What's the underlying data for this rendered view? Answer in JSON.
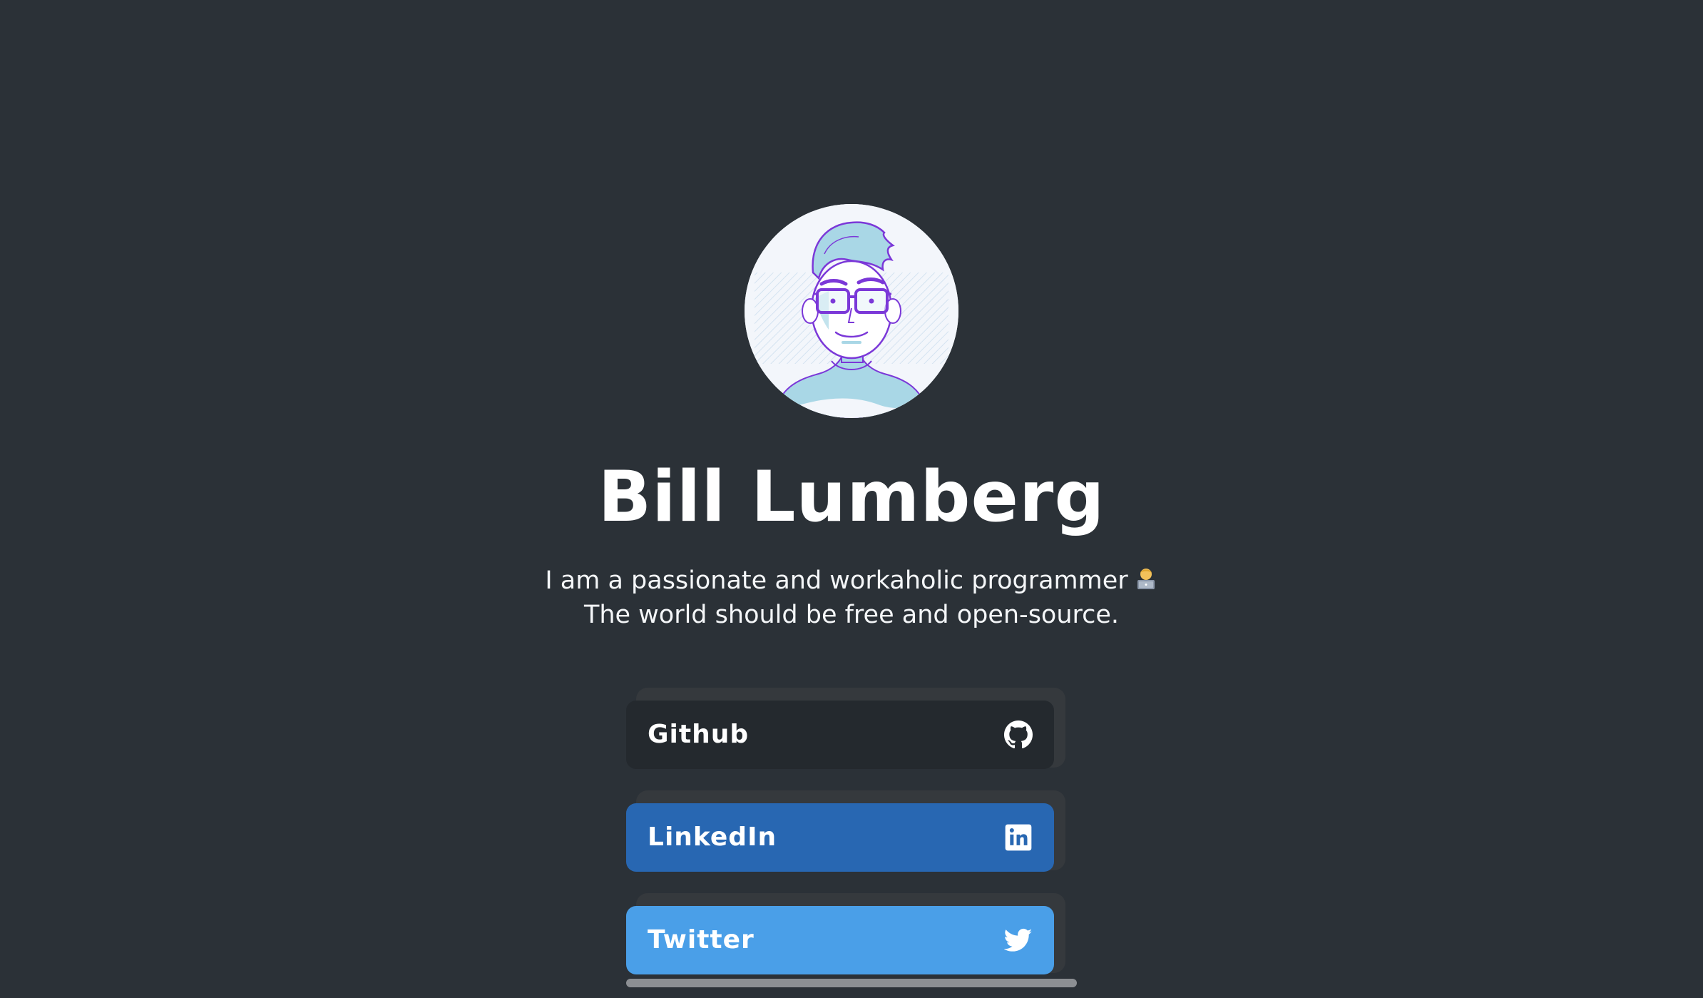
{
  "profile": {
    "name": "Bill Lumberg",
    "bio_line_1": "I am a passionate and workaholic programmer",
    "bio_line_2": "The world should be free and open-source."
  },
  "links": [
    {
      "label": "Github",
      "icon": "github-icon",
      "color": "#24292e"
    },
    {
      "label": "LinkedIn",
      "icon": "linkedin-icon",
      "color": "#2867b2"
    },
    {
      "label": "Twitter",
      "icon": "twitter-icon",
      "color": "#4a9fe8"
    }
  ],
  "colors": {
    "background": "#2b3137",
    "card_shadow": "#35393d",
    "text": "#ffffff"
  }
}
